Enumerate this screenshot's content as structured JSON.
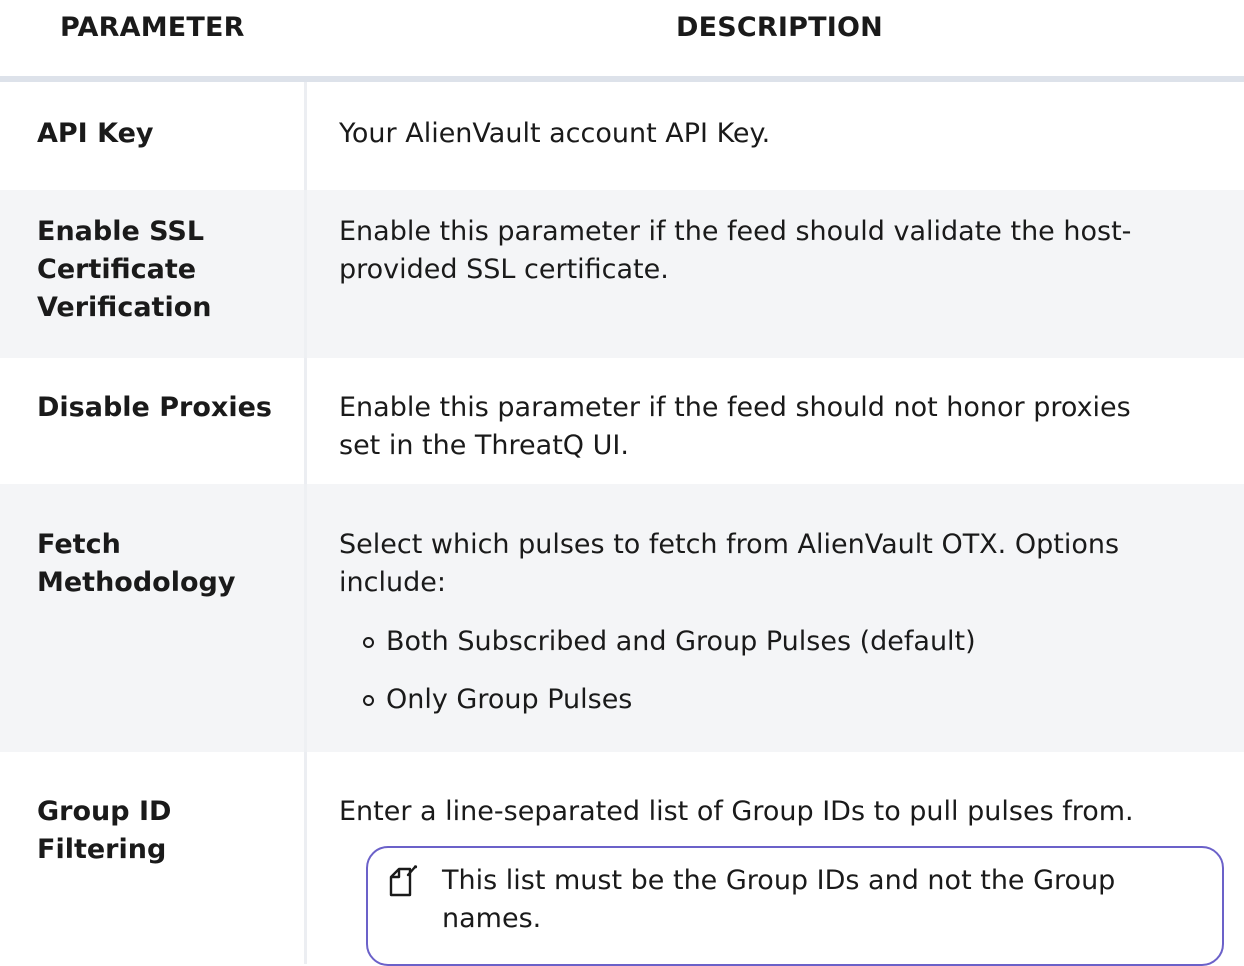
{
  "table": {
    "headers": {
      "parameter": "PARAMETER",
      "description": "DESCRIPTION"
    },
    "rows": [
      {
        "name_lines": [
          "API Key"
        ],
        "desc_lines": [
          "Your AlienVault account API Key."
        ]
      },
      {
        "name_lines": [
          "Enable SSL",
          "Certificate",
          "Verification"
        ],
        "desc_lines": [
          "Enable this parameter if the feed should validate the host-",
          "provided SSL certificate."
        ]
      },
      {
        "name_lines": [
          "Disable Proxies"
        ],
        "desc_lines": [
          "Enable this parameter if the feed should not honor proxies",
          "set in the ThreatQ UI."
        ]
      },
      {
        "name_lines": [
          "Fetch",
          "Methodology"
        ],
        "desc_lines": [
          "Select which pulses to fetch from AlienVault OTX. Options",
          "include:"
        ],
        "options": [
          "Both Subscribed and Group Pulses (default)",
          "Only Group Pulses"
        ]
      },
      {
        "name_lines": [
          "Group ID",
          "Filtering"
        ],
        "desc_lines": [
          "Enter a line-separated list of Group IDs to pull pulses from."
        ],
        "note_lines": [
          "This list must be the Group IDs and not the Group",
          "names."
        ],
        "note_icon": "note-edit-icon"
      }
    ]
  },
  "colors": {
    "callout_border": "#6b61c9",
    "shaded_row": "#f4f5f7",
    "header_rule": "#dde2ea"
  }
}
